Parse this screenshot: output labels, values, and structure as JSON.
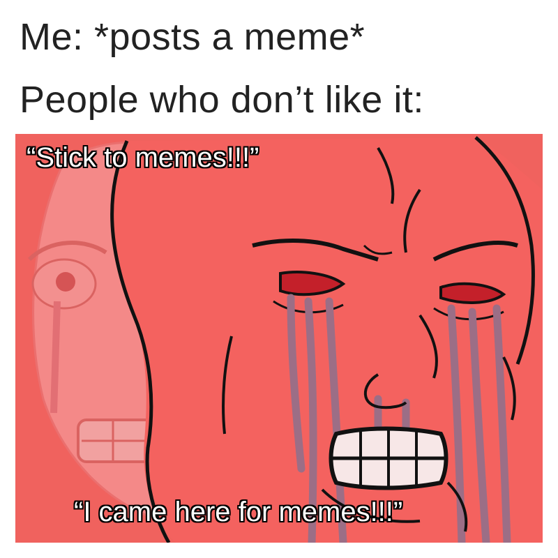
{
  "caption": {
    "line1": "Me: *posts a meme*",
    "line2": "People who don’t like it:"
  },
  "meme": {
    "top_quote": "“Stick to memes!!!”",
    "bottom_quote": "“I came here for memes!!!”",
    "colors": {
      "background": "#f0625e",
      "face": "#f56a66",
      "ghost_face": "#f7a5a8",
      "outline": "#111111",
      "tears": "#9c6e86",
      "eyes": "#c4202a"
    },
    "figures": [
      "crying wojak face",
      "faded crying wojak face"
    ]
  }
}
